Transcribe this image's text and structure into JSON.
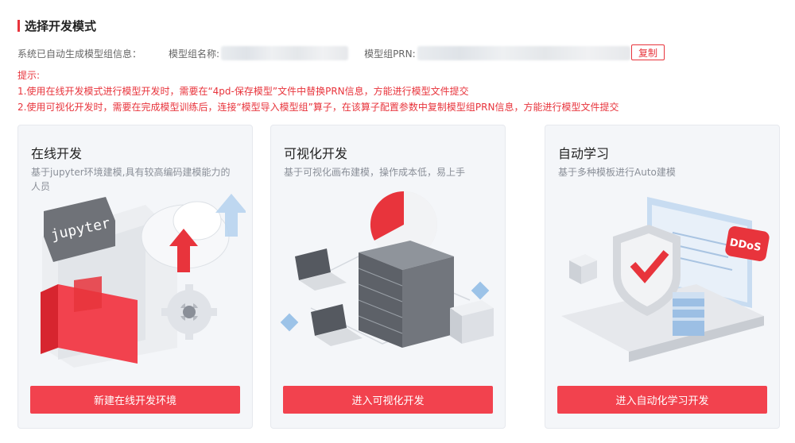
{
  "header": {
    "title": "选择开发模式"
  },
  "info": {
    "system_text": "系统已自动生成模型组信息：",
    "group_name_label": "模型组名称:",
    "group_prn_label": "模型组PRN:",
    "copy_label": "复制"
  },
  "tips": {
    "title": "提示:",
    "line1": "1.使用在线开发模式进行模型开发时，需要在“4pd-保存模型”文件中替换PRN信息，方能进行模型文件提交",
    "line2": "2.使用可视化开发时，需要在完成模型训练后，连接“模型导入模型组”算子，在该算子配置参数中复制模型组PRN信息，方能进行模型文件提交"
  },
  "cards": [
    {
      "title": "在线开发",
      "desc": "基于jupyter环境建模,具有较高编码建模能力的人员",
      "button": "新建在线开发环境",
      "badge": "jupyter"
    },
    {
      "title": "可视化开发",
      "desc": "基于可视化画布建模，操作成本低，易上手",
      "button": "进入可视化开发"
    },
    {
      "title": "自动学习",
      "desc": "基于多种模板进行Auto建模",
      "button": "进入自动化学习开发",
      "badge": "DDoS"
    }
  ],
  "colors": {
    "accent": "#f2424e",
    "title_bar": "#e8343c",
    "card_bg": "#f4f6f9"
  }
}
